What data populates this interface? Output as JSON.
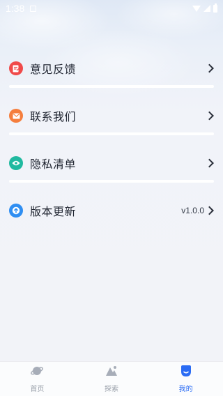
{
  "status_bar": {
    "time": "1:38"
  },
  "menu": {
    "items": [
      {
        "label": "意见反馈",
        "value": "",
        "icon": "feedback-icon",
        "color": "#f04a4a"
      },
      {
        "label": "联系我们",
        "value": "",
        "icon": "mail-icon",
        "color": "#f57e3d"
      },
      {
        "label": "隐私清单",
        "value": "",
        "icon": "eye-icon",
        "color": "#20b9a0"
      },
      {
        "label": "版本更新",
        "value": "v1.0.0",
        "icon": "upload-icon",
        "color": "#2f8ef2"
      }
    ]
  },
  "tabbar": {
    "tabs": [
      {
        "label": "首页",
        "icon": "planet-icon",
        "active": false
      },
      {
        "label": "探索",
        "icon": "mountain-icon",
        "active": false
      },
      {
        "label": "我的",
        "icon": "profile-icon",
        "active": true
      }
    ],
    "active_color": "#2b6cf4",
    "inactive_color": "#9aa0aa"
  }
}
